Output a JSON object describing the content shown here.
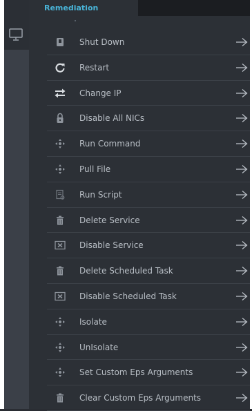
{
  "tab": {
    "label": "Remediation"
  },
  "colors": {
    "accent": "#49b4d8",
    "text": "#b9bfc6",
    "icon": "#8e949c"
  },
  "items": [
    {
      "label": "Shut Down",
      "icon": "power-icon"
    },
    {
      "label": "Restart",
      "icon": "restart-icon"
    },
    {
      "label": "Change IP",
      "icon": "swap-arrows-icon"
    },
    {
      "label": "Disable All NICs",
      "icon": "lock-icon"
    },
    {
      "label": "Run Command",
      "icon": "move-icon"
    },
    {
      "label": "Pull File",
      "icon": "move-icon"
    },
    {
      "label": "Run Script",
      "icon": "script-icon"
    },
    {
      "label": "Delete Service",
      "icon": "trash-icon"
    },
    {
      "label": "Disable Service",
      "icon": "disable-box-icon"
    },
    {
      "label": "Delete Scheduled Task",
      "icon": "trash-icon"
    },
    {
      "label": "Disable Scheduled Task",
      "icon": "disable-box-icon"
    },
    {
      "label": "Isolate",
      "icon": "move-icon"
    },
    {
      "label": "UnIsolate",
      "icon": "move-icon"
    },
    {
      "label": "Set Custom Eps Arguments",
      "icon": "move-icon"
    },
    {
      "label": "Clear Custom Eps Arguments",
      "icon": "trash-icon"
    }
  ]
}
